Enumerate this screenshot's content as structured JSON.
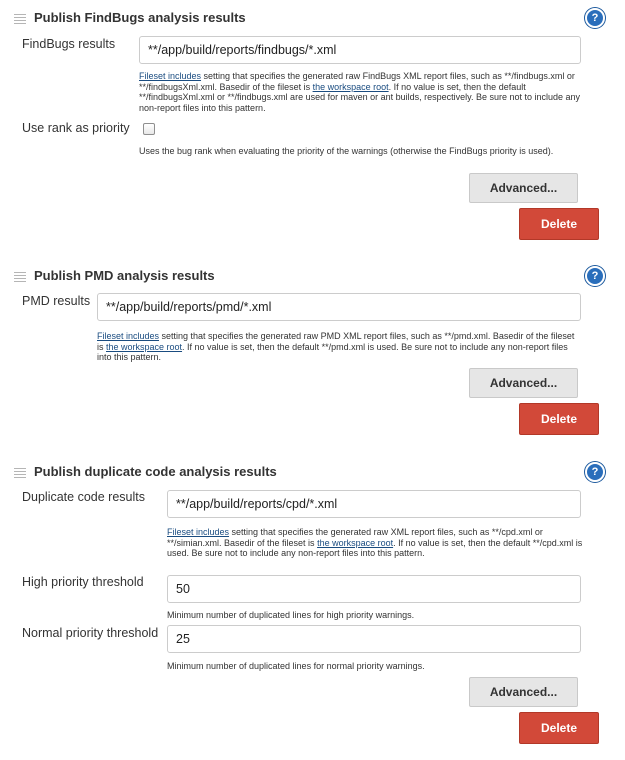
{
  "findbugs": {
    "title": "Publish FindBugs analysis results",
    "results_label": "FindBugs results",
    "results_value": "**/app/build/reports/findbugs/*.xml",
    "help_link1": "Fileset includes",
    "help_part1": " setting that specifies the generated raw FindBugs XML report files, such as **/findbugs.xml or **/findbugsXml.xml. Basedir of the fileset is ",
    "help_link2": "the workspace root",
    "help_part2": ". If no value is set, then the default **/findbugsXml.xml or **/findbugs.xml are used for maven or ant builds, respectively. Be sure not to include any non-report files into this pattern.",
    "rank_label": "Use rank as priority",
    "rank_checked": false,
    "rank_help": "Uses the bug rank when evaluating the priority of the warnings (otherwise the FindBugs priority is used).",
    "advanced_label": "Advanced...",
    "delete_label": "Delete"
  },
  "pmd": {
    "title": "Publish PMD analysis results",
    "results_label": "PMD results",
    "results_value": "**/app/build/reports/pmd/*.xml",
    "help_link1": "Fileset includes",
    "help_part1": " setting that specifies the generated raw PMD XML report files, such as **/pmd.xml. Basedir of the fileset is ",
    "help_link2": "the workspace root",
    "help_part2": ". If no value is set, then the default **/pmd.xml is used. Be sure not to include any non-report files into this pattern.",
    "advanced_label": "Advanced...",
    "delete_label": "Delete"
  },
  "cpd": {
    "title": "Publish duplicate code analysis results",
    "results_label": "Duplicate code results",
    "results_value": "**/app/build/reports/cpd/*.xml",
    "help_link1": "Fileset includes",
    "help_part1": " setting that specifies the generated raw XML report files, such as **/cpd.xml or **/simian.xml. Basedir of the fileset is ",
    "help_link2": "the workspace root",
    "help_part2": ". If no value is set, then the default **/cpd.xml is used. Be sure not to include any non-report files into this pattern.",
    "high_label": "High priority threshold",
    "high_value": "50",
    "high_help": "Minimum number of duplicated lines for high priority warnings.",
    "normal_label": "Normal priority threshold",
    "normal_value": "25",
    "normal_help": "Minimum number of duplicated lines for normal priority warnings.",
    "advanced_label": "Advanced...",
    "delete_label": "Delete"
  },
  "icons": {
    "help": "help-icon",
    "drag": "drag-handle-icon"
  },
  "help_icon_glyph": "?",
  "colors": {
    "delete": "#d24939",
    "help_icon": "#2a6ebb",
    "link": "#1a4c80"
  }
}
